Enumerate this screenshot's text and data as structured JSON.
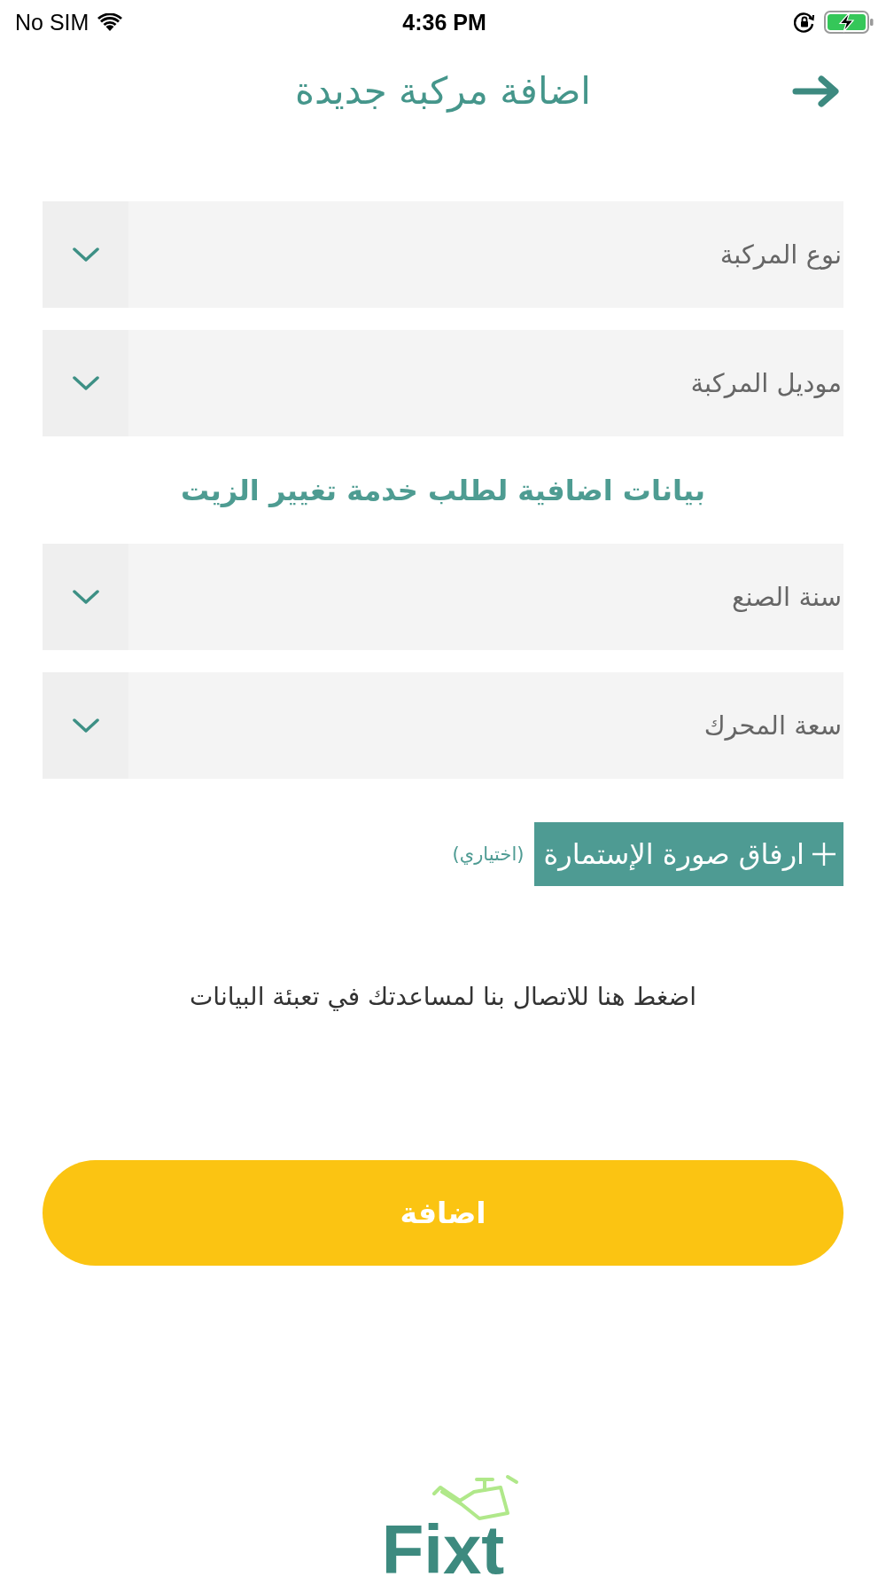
{
  "status_bar": {
    "carrier": "No SIM",
    "time": "4:36 PM"
  },
  "header": {
    "title": "اضافة مركبة جديدة"
  },
  "vehicle_fields": [
    {
      "placeholder": "نوع المركبة"
    },
    {
      "placeholder": "موديل المركبة"
    }
  ],
  "oil_service": {
    "title": "بيانات اضافية لطلب خدمة تغيير الزيت",
    "fields": [
      {
        "placeholder": "سنة الصنع"
      },
      {
        "placeholder": "سعة المحرك"
      }
    ]
  },
  "attachment": {
    "button": "ارفاق صورة الإستمارة",
    "note": "(اختياري)"
  },
  "help_link": "اضغط هنا للاتصال بنا لمساعدتك في تعبئة البيانات",
  "submit_button": "اضافة",
  "logo": {
    "text": "Fixt"
  }
}
